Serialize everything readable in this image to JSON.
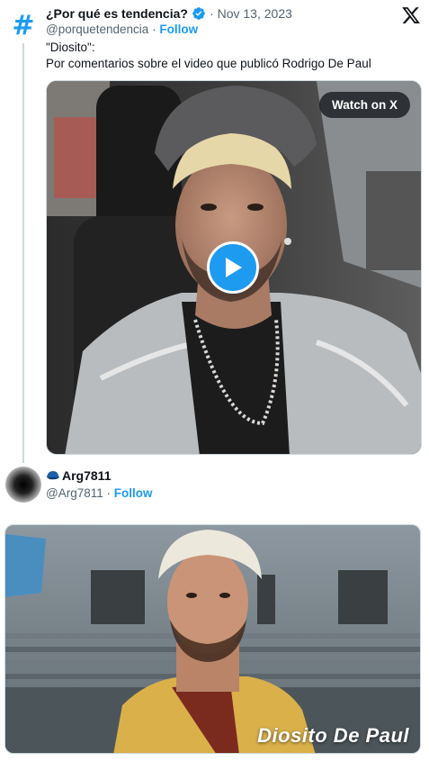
{
  "tweet": {
    "author_name": "¿Por qué es tendencia?",
    "separator": "·",
    "date": "Nov 13, 2023",
    "handle": "@porquetendencia",
    "follow_label": "Follow",
    "text": "\"Diosito\":\nPor comentarios sobre el video que publicó Rodrigo De Paul",
    "watch_label": "Watch on X"
  },
  "reply": {
    "author_name": "Arg7811",
    "handle": "@Arg7811",
    "follow_label": "Follow",
    "video_caption": "Diosito De Paul"
  },
  "colors": {
    "accent": "#1d9bf0",
    "muted": "#536471",
    "text": "#0f1419",
    "divider": "#cfd9de"
  },
  "icons": {
    "avatar_hash": "#",
    "verified": "verified-badge-icon",
    "x_logo": "x-logo-icon",
    "play": "play-icon",
    "cap": "cap-icon"
  }
}
